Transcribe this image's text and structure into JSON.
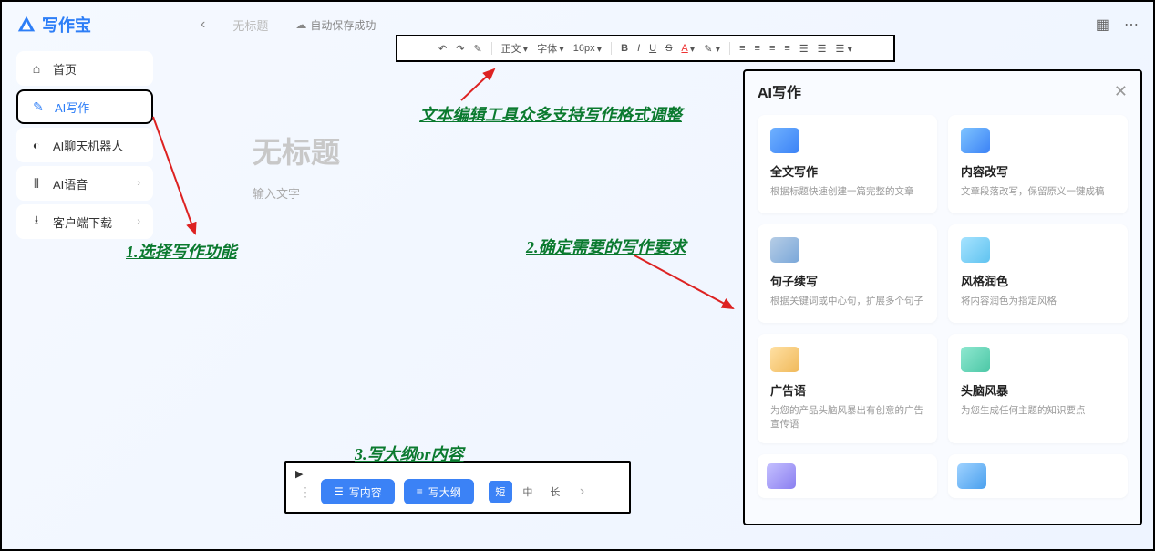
{
  "app": {
    "name": "写作宝",
    "doc_title_top": "无标题",
    "autosave": "自动保存成功"
  },
  "sidebar": {
    "items": [
      {
        "icon": "home",
        "label": "首页"
      },
      {
        "icon": "edit",
        "label": "AI写作"
      },
      {
        "icon": "chat",
        "label": "AI聊天机器人"
      },
      {
        "icon": "voice",
        "label": "AI语音"
      },
      {
        "icon": "download",
        "label": "客户端下载"
      }
    ]
  },
  "toolbar": {
    "format_label": "正文",
    "font_label": "字体",
    "size_label": "16px"
  },
  "editor": {
    "title_placeholder": "无标题",
    "body_placeholder": "输入文字"
  },
  "bottom_bar": {
    "write_content": "写内容",
    "write_outline": "写大纲",
    "length": {
      "short": "短",
      "mid": "中",
      "long": "长"
    }
  },
  "ai_panel": {
    "title": "AI写作",
    "cards": [
      {
        "title": "全文写作",
        "desc": "根据标题快速创建一篇完整的文章",
        "color": "#3b82f6"
      },
      {
        "title": "内容改写",
        "desc": "文章段落改写，保留原义一键成稿",
        "color": "#3b82f6"
      },
      {
        "title": "句子续写",
        "desc": "根据关键词或中心句，扩展多个句子",
        "color": "#7aa7d9"
      },
      {
        "title": "风格润色",
        "desc": "将内容润色为指定风格",
        "color": "#60c3f0"
      },
      {
        "title": "广告语",
        "desc": "为您的产品头脑风暴出有创意的广告宣传语",
        "color": "#f0b95a"
      },
      {
        "title": "头脑风暴",
        "desc": "为您生成任何主题的知识要点",
        "color": "#4cc7a6"
      },
      {
        "title": "",
        "desc": "",
        "color": "#8a7ff0"
      },
      {
        "title": "",
        "desc": "",
        "color": "#4aa0ee"
      }
    ]
  },
  "annotations": {
    "a1": "1.选择写作功能",
    "a2": "2.确定需要的写作要求",
    "a3": "3.写大纲or内容",
    "a_toolbar": "文本编辑工具众多支持写作格式调整"
  }
}
